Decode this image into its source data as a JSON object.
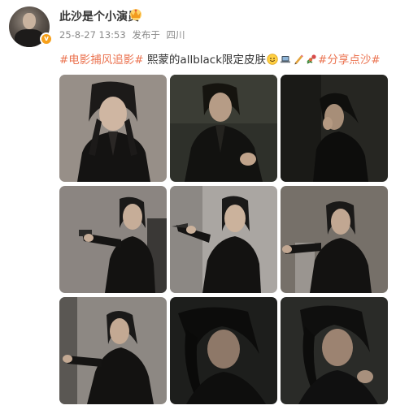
{
  "post": {
    "username": "此沙是个小演员",
    "date": "25-8-27 13:53",
    "source_prefix": "发布于",
    "location": "四川",
    "tag1": "#电影捕风追影#",
    "body_text": " 熙蒙的allblack限定皮肤",
    "tag2": "#分享点沙#",
    "emojis": [
      "smile-emoji",
      "laptop-emoji",
      "pencil-emoji",
      "flower-emoji"
    ]
  },
  "photos": [
    {
      "scene": "studio-standing-portrait"
    },
    {
      "scene": "dark-room-seated"
    },
    {
      "scene": "dark-room-profile"
    },
    {
      "scene": "aiming-gun-left"
    },
    {
      "scene": "aiming-knife-left"
    },
    {
      "scene": "reaching-arm-left"
    },
    {
      "scene": "leaning-pose"
    },
    {
      "scene": "close-up-bowed-head"
    },
    {
      "scene": "close-up-bowed-head-2"
    }
  ]
}
